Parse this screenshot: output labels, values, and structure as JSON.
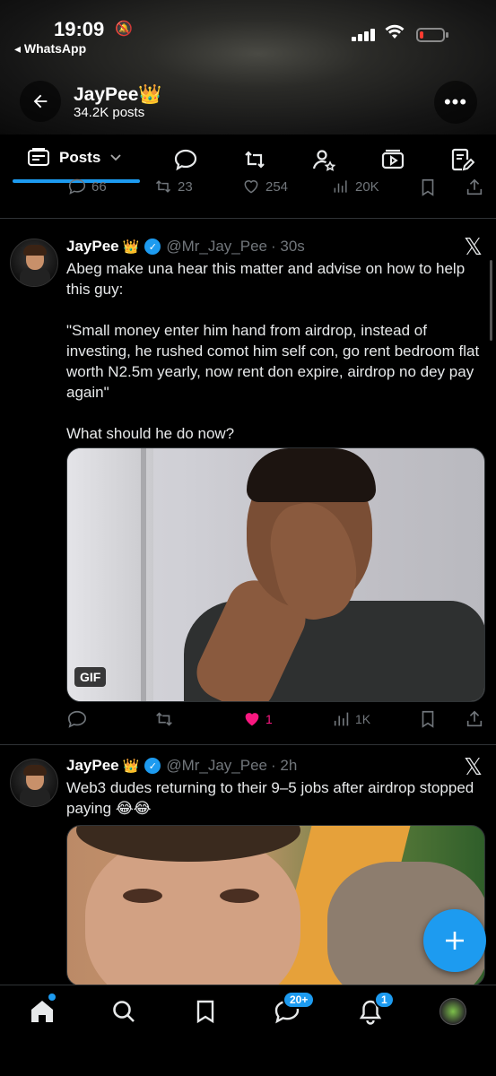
{
  "status_bar": {
    "time": "19:09",
    "back_app": "◂ WhatsApp"
  },
  "header": {
    "name": "JayPee👑",
    "posts_count": "34.2K posts"
  },
  "tabs": {
    "active_label": "Posts",
    "icons": [
      "replies-icon",
      "reposts-icon",
      "affiliates-icon",
      "media-icon",
      "articles-icon"
    ]
  },
  "prev_post_actions": {
    "replies": "66",
    "reposts": "23",
    "likes": "254",
    "views": "20K"
  },
  "tweets": [
    {
      "name": "JayPee",
      "crown": "👑",
      "handle": "@Mr_Jay_Pee",
      "time": "· 30s",
      "text": "Abeg make una hear this matter and advise on how to help this guy:\n\n\"Small money enter him hand from airdrop, instead of investing, he rushed comot him self con, go rent bedroom flat worth N2.5m yearly, now rent don expire, airdrop no dey pay again\"\n\nWhat should he do now?",
      "media_badge": "GIF",
      "likes": "1",
      "views": "1K"
    },
    {
      "name": "JayPee",
      "crown": "👑",
      "handle": "@Mr_Jay_Pee",
      "time": "· 2h",
      "text": "Web3 dudes returning to their 9–5 jobs after airdrop stopped paying 😂😂"
    }
  ],
  "bottom_nav": {
    "messages_badge": "20+",
    "notifications_badge": "1"
  },
  "colors": {
    "accent": "#1d9bf0",
    "like": "#f91880",
    "muted": "#71767b",
    "background": "#000000"
  }
}
